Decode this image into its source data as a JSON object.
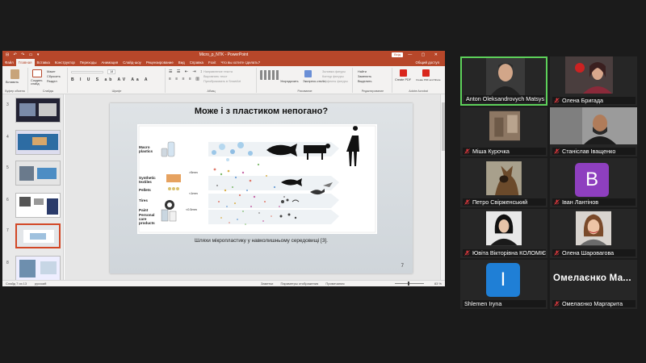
{
  "ppt": {
    "quick_access": "⊟ ↶ ↷ ▭ ▾",
    "title": "Micro_p_NTK - PowerPoint",
    "sign_in": "Вхід",
    "window_controls": "— ▢ ✕",
    "tabs": [
      "Файл",
      "Главная",
      "Вставка",
      "Конструктор",
      "Переходы",
      "Анимация",
      "Слайд-шоу",
      "Рецензирование",
      "Вид",
      "Справка",
      "Foxit",
      "Что вы хотите сделать?"
    ],
    "active_tab": "Главная",
    "share": "Общий доступ",
    "ribbon": {
      "paste": "Вставить",
      "new_slide": "Создать слайд",
      "layout": "Макет",
      "reset": "Сбросить",
      "section": "Раздел",
      "font_size": "18",
      "direction": "Направление текста",
      "align": "Выровнять текст",
      "convert": "Преобразовать в SmartArt",
      "arrange": "Упорядочить",
      "quick_styles": "Экспресс-стили",
      "fill": "Заливка фигуры",
      "outline": "Контур фигуры",
      "effects": "Эффекты фигуры",
      "find": "Найти",
      "replace": "Заменить",
      "select": "Выделить",
      "create_pdf": "Create PDF",
      "create_pdf_share": "Create PDF and Share",
      "groups": [
        "Буфер обмена",
        "Слайды",
        "Шрифт",
        "Абзац",
        "Рисование",
        "Редактирование",
        "Adobe Acrobat"
      ]
    },
    "thumbnail_numbers": [
      "3",
      "4",
      "5",
      "6",
      "7",
      "8"
    ],
    "slide": {
      "title": "Може і з пластиком непогано?",
      "figure_labels": {
        "macro": "Macro plastics",
        "synthetic": "Synthetic textiles",
        "pellets": "Pellets",
        "tires": "Tires",
        "paint": "Paint",
        "personal": "Personal care products",
        "size1": ">5mm",
        "size2": "<1mm",
        "size3": "<0.5mm"
      },
      "caption": "Шляхи мікропластику у навколишньому середовищі [3].",
      "number": "7"
    },
    "status": {
      "slide_count": "Слайд 7 из 13",
      "language": "русский",
      "notes": "Заметки",
      "comments": "Параметры отображения",
      "display": "Примечания",
      "zoom": "83 %"
    }
  },
  "participants": [
    {
      "name": "Anton Oleksandrovych Matsyshyn",
      "active": true,
      "muted": false,
      "type": "video"
    },
    {
      "name": "Олена Бригада",
      "muted": true,
      "type": "video"
    },
    {
      "name": "Міша Курочка",
      "muted": true,
      "type": "video"
    },
    {
      "name": "Станіслав Іващенко",
      "muted": true,
      "type": "video"
    },
    {
      "name": "Петро Свірженський",
      "muted": true,
      "type": "photo"
    },
    {
      "name": "Іван Лантінов",
      "muted": true,
      "type": "avatar",
      "letter": "B",
      "color": "#8e3fbf"
    },
    {
      "name": "Ювіта Вікторівна КОЛОМІЄЦЬ",
      "muted": true,
      "type": "photo"
    },
    {
      "name": "Олена Шаровагова",
      "muted": true,
      "type": "photo"
    },
    {
      "name": "Shlemen Iryna",
      "muted": false,
      "type": "avatar",
      "letter": "I",
      "color": "#1f7fd6"
    },
    {
      "name": "Омелаєнко Маргарита",
      "muted": true,
      "type": "name",
      "display": "Омелаєнко  Ма..."
    }
  ],
  "colors": {
    "ppt_accent": "#b7472a",
    "active_speaker": "#5dd15a",
    "muted_red": "#e0393e"
  }
}
